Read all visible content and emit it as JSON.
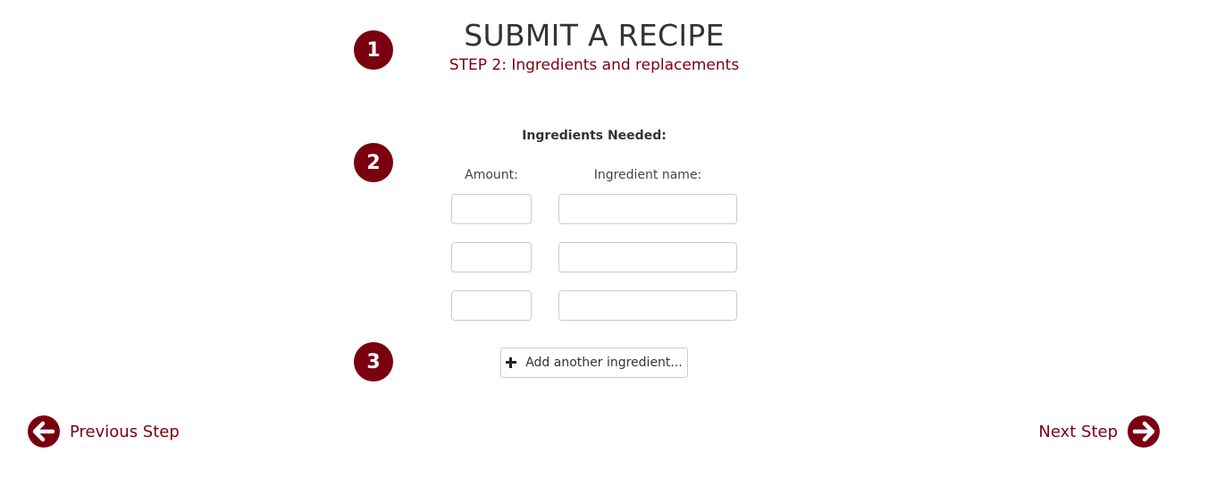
{
  "header": {
    "title": "SUBMIT A RECIPE",
    "subtitle": "STEP 2: Ingredients and replacements"
  },
  "steps": [
    "1",
    "2",
    "3"
  ],
  "ingredients": {
    "heading": "Ingredients Needed:",
    "amount_label": "Amount:",
    "name_label": "Ingredient name:",
    "rows": [
      {
        "amount": "",
        "name": ""
      },
      {
        "amount": "",
        "name": ""
      },
      {
        "amount": "",
        "name": ""
      }
    ],
    "add_button_label": "Add another ingredient...",
    "add_button_icon": "plus-icon"
  },
  "navigation": {
    "previous_label": "Previous Step",
    "previous_icon": "arrow-left-circle-icon",
    "next_label": "Next Step",
    "next_icon": "arrow-right-circle-icon"
  },
  "colors": {
    "accent": "#7a0010",
    "text": "#333333",
    "border": "#cccccc"
  }
}
